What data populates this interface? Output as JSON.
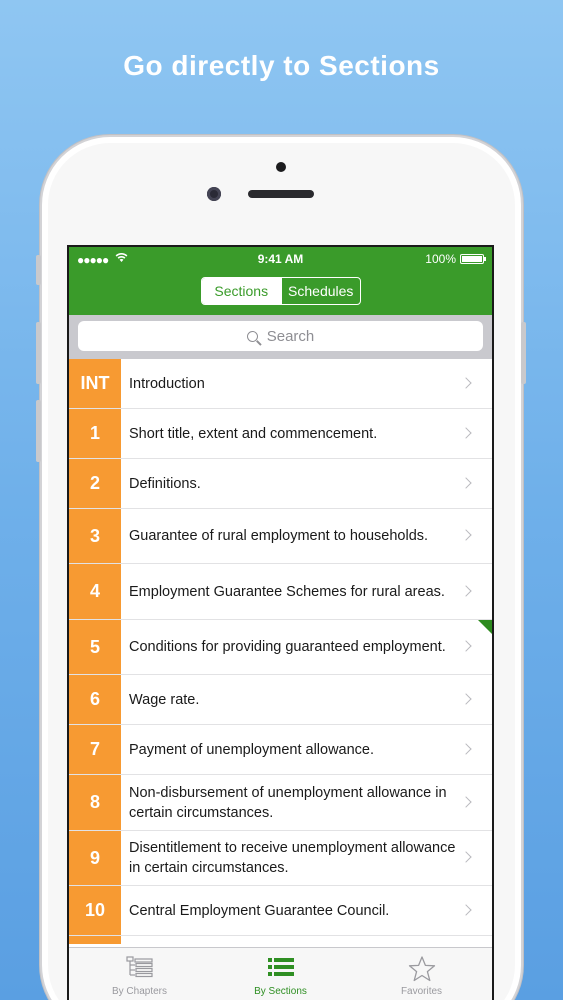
{
  "headline": "Go directly to Sections",
  "status_bar": {
    "signal": "●●●●●",
    "wifi": "(((",
    "time": "9:41 AM",
    "battery": "100%"
  },
  "segment": {
    "sections_label": "Sections",
    "schedules_label": "Schedules"
  },
  "search": {
    "placeholder": "Search"
  },
  "sections": [
    {
      "num": "INT",
      "title": "Introduction"
    },
    {
      "num": "1",
      "title": "Short title, extent and commencement."
    },
    {
      "num": "2",
      "title": "Definitions."
    },
    {
      "num": "3",
      "title": "Guarantee of rural employment to households."
    },
    {
      "num": "4",
      "title": "Employment Guarantee Schemes for rural areas."
    },
    {
      "num": "5",
      "title": "Conditions for providing guaranteed employment."
    },
    {
      "num": "6",
      "title": "Wage rate."
    },
    {
      "num": "7",
      "title": "Payment of unemployment allowance."
    },
    {
      "num": "8",
      "title": "Non-disbursement of unemployment allowance in certain circumstances."
    },
    {
      "num": "9",
      "title": "Disentitlement to receive unemployment allowance in certain circumstances."
    },
    {
      "num": "10",
      "title": "Central Employment Guarantee Council."
    }
  ],
  "tabs": [
    {
      "label": "By Chapters",
      "icon": "chapters-tree-icon"
    },
    {
      "label": "By Sections",
      "icon": "sections-list-icon"
    },
    {
      "label": "Favorites",
      "icon": "star-icon"
    }
  ],
  "colors": {
    "nav_green": "#3a9b2a",
    "section_orange": "#f79a32",
    "tab_active": "#2f8f23"
  }
}
